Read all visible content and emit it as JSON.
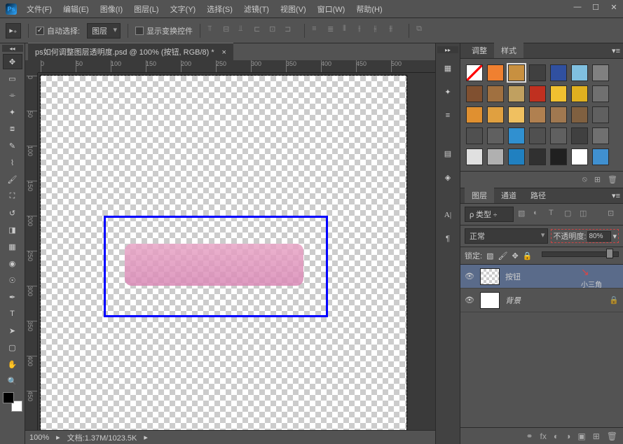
{
  "app": {
    "logo": "Ps"
  },
  "menu": [
    "文件(F)",
    "编辑(E)",
    "图像(I)",
    "图层(L)",
    "文字(Y)",
    "选择(S)",
    "滤镜(T)",
    "视图(V)",
    "窗口(W)",
    "帮助(H)"
  ],
  "window_controls": {
    "minimize": "—",
    "restore": "☐",
    "close": "✕",
    "separator": "▾"
  },
  "options": {
    "auto_select_label": "自动选择:",
    "auto_select_checked": true,
    "auto_select_target": "图层",
    "show_transform": "显示变换控件",
    "show_transform_checked": false
  },
  "document": {
    "tab": "ps如何调整图层透明度.psd @ 100% (按钮, RGB/8) *",
    "ruler_marks_h": [
      "0",
      "50",
      "100",
      "150",
      "200",
      "250",
      "300",
      "350",
      "400",
      "450",
      "500"
    ],
    "ruler_marks_v": [
      "0",
      "50",
      "100",
      "150",
      "200",
      "250",
      "300",
      "350",
      "400",
      "450"
    ]
  },
  "status": {
    "zoom": "100%",
    "doc_info": "文档:1.37M/1023.5K"
  },
  "swatch_tabs": {
    "adjust": "调整",
    "styles": "样式"
  },
  "swatch_colors": [
    "#ffffff",
    "#f08030",
    "#c89040",
    "#404040",
    "#3050a0",
    "#80c0e0",
    "#808080",
    "#805030",
    "#a07040",
    "#c0a060",
    "#c03020",
    "#f0c030",
    "#e0b020",
    "#707070",
    "#e09030",
    "#e0a040",
    "#f0c060",
    "#b08050",
    "#a07850",
    "#806040",
    "#606060",
    "#505050",
    "#606060",
    "#3090d0",
    "#505050",
    "#606060",
    "#404040",
    "#707070",
    "#e0e0e0",
    "#b0b0b0",
    "#2080c0",
    "#303030",
    "#202020",
    "#ffffff",
    "#4090d0"
  ],
  "layers_panel": {
    "tabs": {
      "layers": "图层",
      "channels": "通道",
      "paths": "路径"
    },
    "filter": "类型",
    "search_icon": "ρ",
    "blend_mode": "正常",
    "opacity_label": "不透明度:",
    "opacity_value": "80%",
    "lock_label": "锁定:",
    "layers": [
      {
        "name": "按钮",
        "visible": true,
        "active": true,
        "locked": false
      },
      {
        "name": "背景",
        "visible": true,
        "active": false,
        "locked": true
      }
    ],
    "annotation": "小三角"
  },
  "footer_icons": {
    "link": "⚭",
    "fx": "fx",
    "mask": "◐",
    "adjust": "◑",
    "group": "▣",
    "new": "⊞",
    "trash": "🗑"
  }
}
